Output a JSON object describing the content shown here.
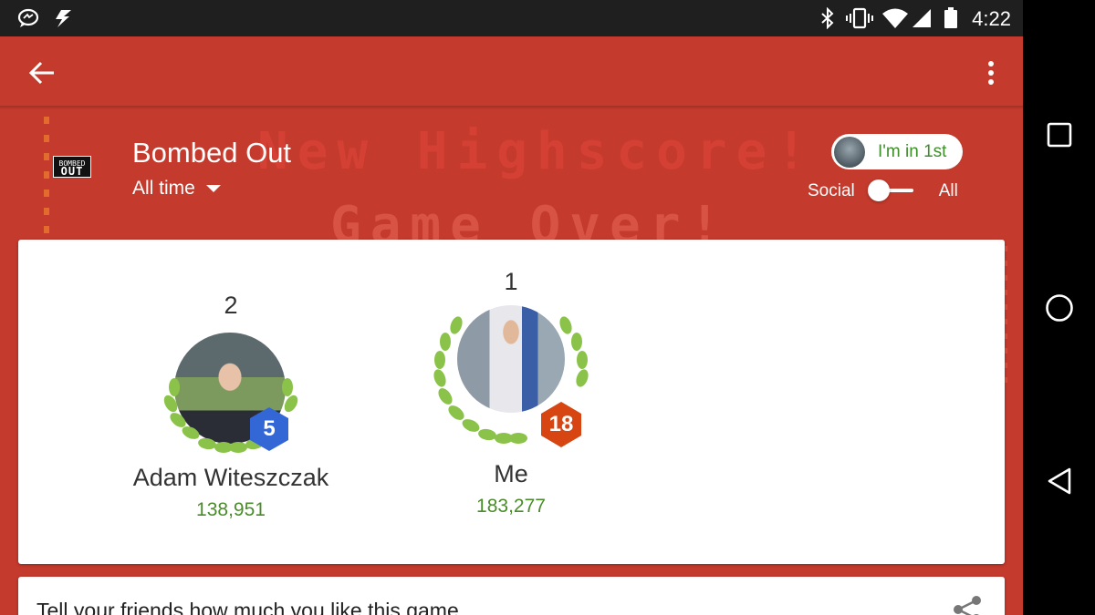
{
  "status_bar": {
    "time": "4:22",
    "icons": [
      "messenger-icon",
      "flash-icon",
      "bluetooth-icon",
      "vibrate-icon",
      "wifi-icon",
      "signal-icon",
      "battery-icon"
    ]
  },
  "toolbar": {
    "back_icon": "arrow-left-icon",
    "overflow_icon": "more-vert-icon"
  },
  "background": {
    "highscore_text": "New Highscore!",
    "gameover_text": "Game Over!"
  },
  "game": {
    "logo_top": "BOMBED",
    "logo_bottom": "OUT",
    "title": "Bombed Out",
    "time_filter": "All time"
  },
  "rank_chip": {
    "label": "I'm in 1st"
  },
  "collection_toggle": {
    "left_label": "Social",
    "right_label": "All",
    "selected": "Social"
  },
  "leaderboard": [
    {
      "rank": "2",
      "name": "Adam Witeszczak",
      "score": "138,951",
      "level": "5",
      "badge_color": "#3367d6"
    },
    {
      "rank": "1",
      "name": "Me",
      "score": "183,277",
      "level": "18",
      "badge_color": "#d64512"
    }
  ],
  "colors": {
    "app_red": "#c43a2c",
    "score_green": "#4a8c2a",
    "wreath_green": "#8bc34a"
  },
  "promo_card": {
    "text": "Tell your friends how much you like this game"
  }
}
